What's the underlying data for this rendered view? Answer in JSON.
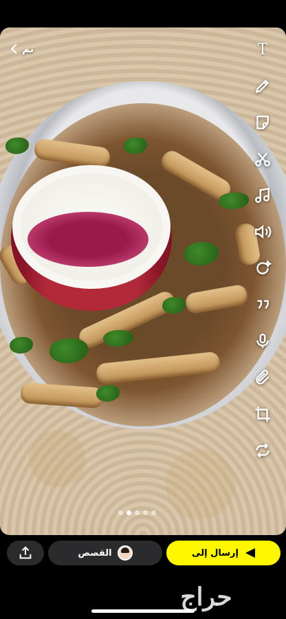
{
  "header": {
    "done_label": "تم"
  },
  "toolbar": {
    "text_tool": "T",
    "tools": [
      "text-icon",
      "pencil-icon",
      "sticker-icon",
      "scissors-icon",
      "music-icon",
      "volume-icon",
      "magic-eraser-icon",
      "quote-icon",
      "microphone-icon",
      "paperclip-icon",
      "crop-icon",
      "loop-icon"
    ]
  },
  "pager": {
    "count": 5,
    "active_index": 1
  },
  "bottom": {
    "stories_label": "القصص",
    "send_label": "إرسال إلى",
    "accent": "#fff700"
  },
  "watermark": {
    "text": "حراج"
  }
}
